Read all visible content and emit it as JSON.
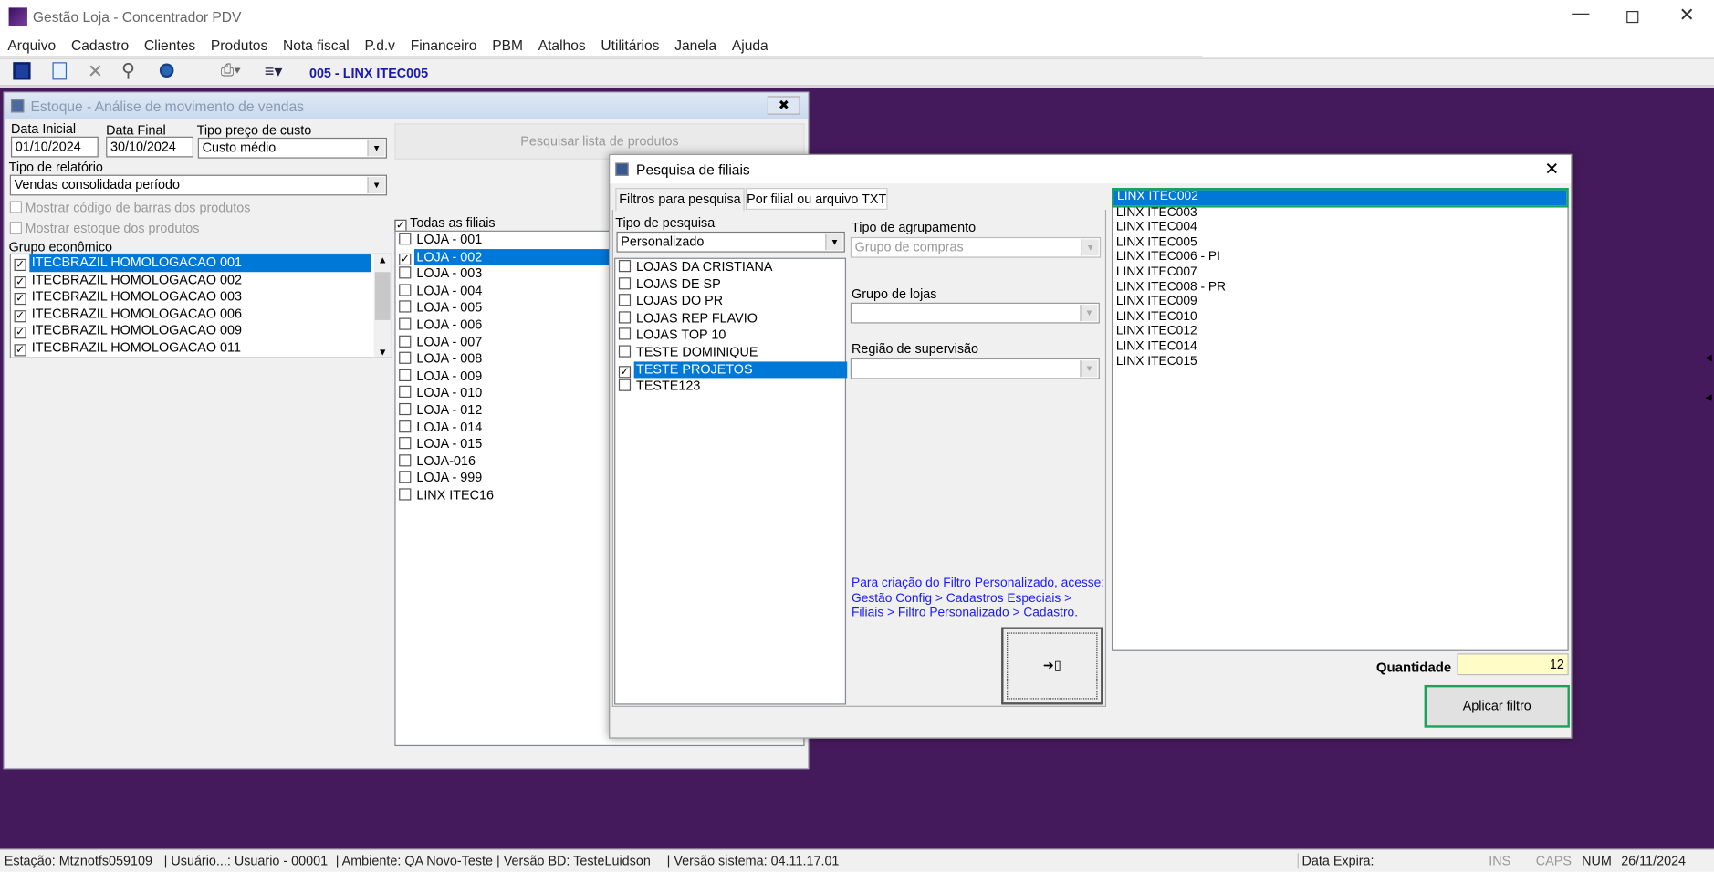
{
  "app": {
    "title": "Gestão Loja - Concentrador PDV",
    "menu": [
      "Arquivo",
      "Cadastro",
      "Clientes",
      "Produtos",
      "Nota fiscal",
      "P.d.v",
      "Financeiro",
      "PBM",
      "Atalhos",
      "Utilitários",
      "Janela",
      "Ajuda"
    ],
    "store": "005 - LINX ITEC005",
    "colors": {
      "mdi": "#451a5c",
      "selection": "#0078d7",
      "highlight_border": "#1aa35a"
    }
  },
  "estoque": {
    "title": "Estoque - Análise de movimento de vendas",
    "data_inicial_label": "Data Inicial",
    "data_inicial": "01/10/2024",
    "data_final_label": "Data Final",
    "data_final": "30/10/2024",
    "tipo_preco_label": "Tipo preço de custo",
    "tipo_preco": "Custo médio",
    "pesquisar": "Pesquisar lista de produtos",
    "tipo_relatorio_label": "Tipo de relatório",
    "tipo_relatorio": "Vendas consolidada período",
    "mostrar_codigo": "Mostrar código de barras dos produtos",
    "mostrar_estoque": "Mostrar estoque dos produtos",
    "grupo_label": "Grupo econômico",
    "grupos": [
      "ITECBRAZIL HOMOLOGACAO 001",
      "ITECBRAZIL HOMOLOGACAO 002",
      "ITECBRAZIL HOMOLOGACAO 003",
      "ITECBRAZIL HOMOLOGACAO 006",
      "ITECBRAZIL HOMOLOGACAO 009",
      "ITECBRAZIL HOMOLOGACAO 011"
    ],
    "todas_filiais": "Todas as filiais",
    "lojas": [
      "LOJA - 001",
      "LOJA - 002",
      "LOJA - 003",
      "LOJA - 004",
      "LOJA - 005",
      "LOJA - 006",
      "LOJA - 007",
      "LOJA - 008",
      "LOJA - 009",
      "LOJA - 010",
      "LOJA - 012",
      "LOJA - 014",
      "LOJA - 015",
      "LOJA-016",
      "LOJA - 999",
      "LINX ITEC16"
    ],
    "loja_checked": [
      false,
      true,
      false,
      false,
      false,
      false,
      false,
      false,
      false,
      false,
      false,
      false,
      false,
      false,
      false,
      false
    ]
  },
  "dialog": {
    "title": "Pesquisa de filiais",
    "tabs": [
      "Filtros para pesquisa",
      "Por filial ou arquivo TXT"
    ],
    "tipo_pesquisa_label": "Tipo de pesquisa",
    "tipo_pesquisa": "Personalizado",
    "filtros": [
      "LOJAS DA CRISTIANA",
      "LOJAS DE SP",
      "LOJAS DO PR",
      "LOJAS REP FLAVIO",
      "LOJAS TOP 10",
      "TESTE DOMINIQUE",
      "TESTE PROJETOS",
      "TESTE123"
    ],
    "filtro_checked": [
      false,
      false,
      false,
      false,
      false,
      false,
      true,
      false
    ],
    "agrupamento_label": "Tipo de agrupamento",
    "agrupamento": "Grupo de compras",
    "grupo_lojas_label": "Grupo de lojas",
    "regiao_label": "Região de supervisão",
    "info": "Para criação do Filtro Personalizado, acesse: Gestão Config > Cadastros Especiais > Filiais > Filtro Personalizado > Cadastro.",
    "resultados": [
      "LINX ITEC002",
      "LINX ITEC003",
      "LINX ITEC004",
      "LINX ITEC005",
      "LINX ITEC006 - PI",
      "LINX ITEC007",
      "LINX ITEC008 - PR",
      "LINX ITEC009",
      "LINX ITEC010",
      "LINX ITEC012",
      "LINX ITEC014",
      "LINX ITEC015"
    ],
    "quantidade_label": "Quantidade",
    "quantidade": "12",
    "aplicar": "Aplicar filtro"
  },
  "status": {
    "estacao": "Estação: Mtznotfs059109",
    "usuario": "| Usuário...: Usuario - 00001",
    "ambiente": "| Ambiente: QA Novo-Teste | Versão BD: TesteLuidson",
    "versao": "| Versão sistema: 04.11.17.01",
    "expira": "Data Expira:",
    "ins": "INS",
    "caps": "CAPS",
    "num": "NUM",
    "data": "26/11/2024"
  }
}
